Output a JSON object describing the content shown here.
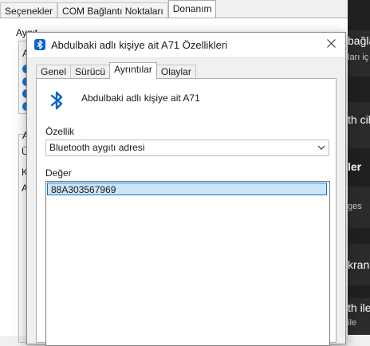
{
  "background_dialog": {
    "tabs": [
      "Seçenekler",
      "COM Bağlantı Noktaları",
      "Donanım"
    ],
    "active_tab_index": 2,
    "fragments": [
      "Aygıt",
      "A",
      "A",
      "Ü",
      "K",
      "A"
    ],
    "accent": "#1976d2"
  },
  "right_window": {
    "lines": [
      "bağla",
      "ları iç",
      "th cih",
      "ler",
      "ges",
      "kran",
      "th ile",
      "ile"
    ]
  },
  "dialog": {
    "title": "Abdulbaki adlı kişiye ait A71 Özellikleri",
    "close_icon": "close-icon",
    "tabs": [
      "Genel",
      "Sürücü",
      "Ayrıntılar",
      "Olaylar"
    ],
    "active_tab_index": 2,
    "device_icon": "bluetooth-icon",
    "device_name": "Abdulbaki adlı kişiye ait A71",
    "property_label": "Özellik",
    "property_selected": "Bluetooth aygıtı adresi",
    "value_label": "Değer",
    "values": [
      "88A303567969"
    ],
    "selection_color": "#cce4f7",
    "accent": "#0078d7"
  }
}
